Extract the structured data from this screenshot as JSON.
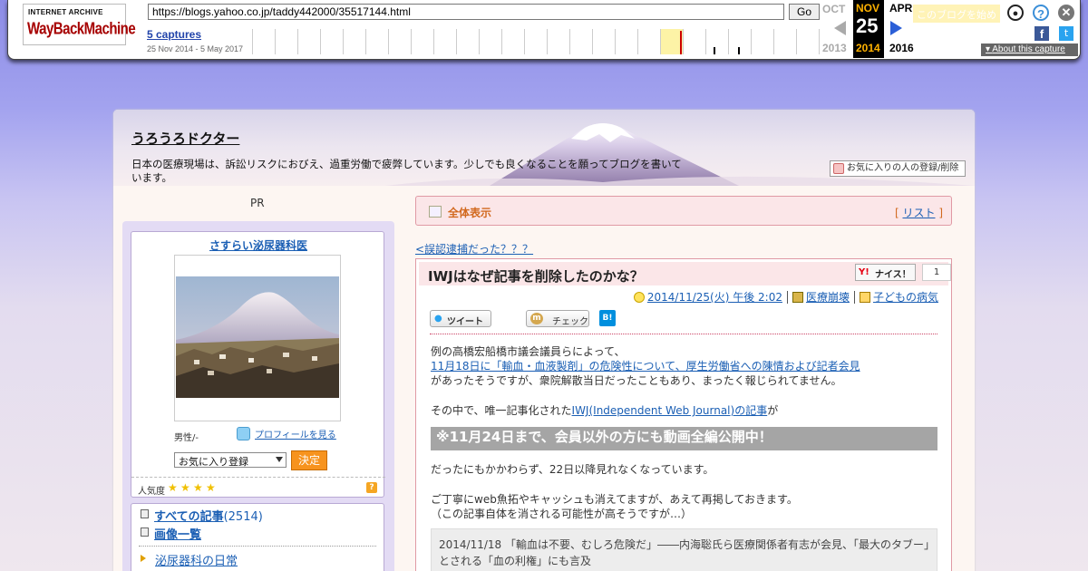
{
  "wayback": {
    "logo_top": "INTERNET ARCHIVE",
    "logo_main": "WayBackMachine",
    "url": "https://blogs.yahoo.co.jp/taddy442000/35517144.html",
    "go_label": "Go",
    "captures_label": "5 captures",
    "date_range": "25 Nov 2014 - 5 May 2017",
    "prev_month": "OCT",
    "prev_year": "2013",
    "current_month": "NOV",
    "current_day": "25",
    "current_year": "2014",
    "next_month": "APR",
    "next_year": "2016",
    "ghost_text": "このブログを始める",
    "about_label": "About this capture",
    "facebook_glyph": "f",
    "twitter_glyph": "t"
  },
  "colors": {
    "accent_link": "#1b5fb4",
    "orange": "#f7931e",
    "pink_border": "#e09aa5",
    "wayback_selected": "#ffb200"
  },
  "blog": {
    "title": "うろうろドクター",
    "description": "日本の医療現場は、訴訟リスクにおびえ、過重労働で疲弊しています。少しでも良くなることを願ってブログを書いています。",
    "fav_register_label": "お気に入りの人の登録/削除"
  },
  "sidebar": {
    "pr": "PR",
    "profile_name": "さすらい泌尿器科医",
    "gender": "男性/-",
    "profile_link": "プロフィールを見る",
    "fav_select": "お気に入り登録",
    "decide_label": "決定",
    "popularity_label": "人気度",
    "popularity_stars": 4,
    "help_glyph": "?",
    "all_posts_label": "すべての記事",
    "all_posts_count": "(2514)",
    "images_label": "画像一覧",
    "category_1": "泌尿器科の日常"
  },
  "main": {
    "all_view_label": "全体表示",
    "list_bracket_open": "[ ",
    "list_label": "リスト",
    "list_bracket_close": " ]",
    "prev_article": "<誤認逮捕だった？？？",
    "article_title": "IWJはなぜ記事を削除したのかな？",
    "nice_yahoo": "Y!",
    "nice_label": "ナイス！",
    "nice_count": "1",
    "post_date": "2014/11/25(火) 午後 2:02",
    "tag_1": "医療崩壊",
    "tag_2": "子どもの病気",
    "tweet_label": "ツイート",
    "check_label": "チェック",
    "hatena_label": "B!",
    "body_1": "例の高橋宏船橋市議会議員らによって、",
    "body_link_1": "11月18日に「輸血・血液製剤」の危険性について、厚生労働省への陳情および記者会見",
    "body_2": "があったそうですが、衆院解散当日だったこともあり、まったく報じられてません。",
    "body_3": "その中で、唯一記事化された",
    "body_link_2": "IWJ(Independent Web Journal)の記事",
    "body_3b": "が",
    "callout": "※11月24日まで、会員以外の方にも動画全編公開中！",
    "body_4": "だったにもかかわらず、22日以降見れなくなっています。",
    "body_5": "ご丁寧にweb魚拓やキャッシュも消えてますが、あえて再掲しておきます。",
    "body_6": "（この記事自体を消される可能性が高そうですが…）",
    "quote": "2014/11/18 「輸血は不要、むしろ危険だ」――内海聡氏ら医療関係者有志が会見、「最大のタブー」とされる「血の利権」にも言及"
  }
}
